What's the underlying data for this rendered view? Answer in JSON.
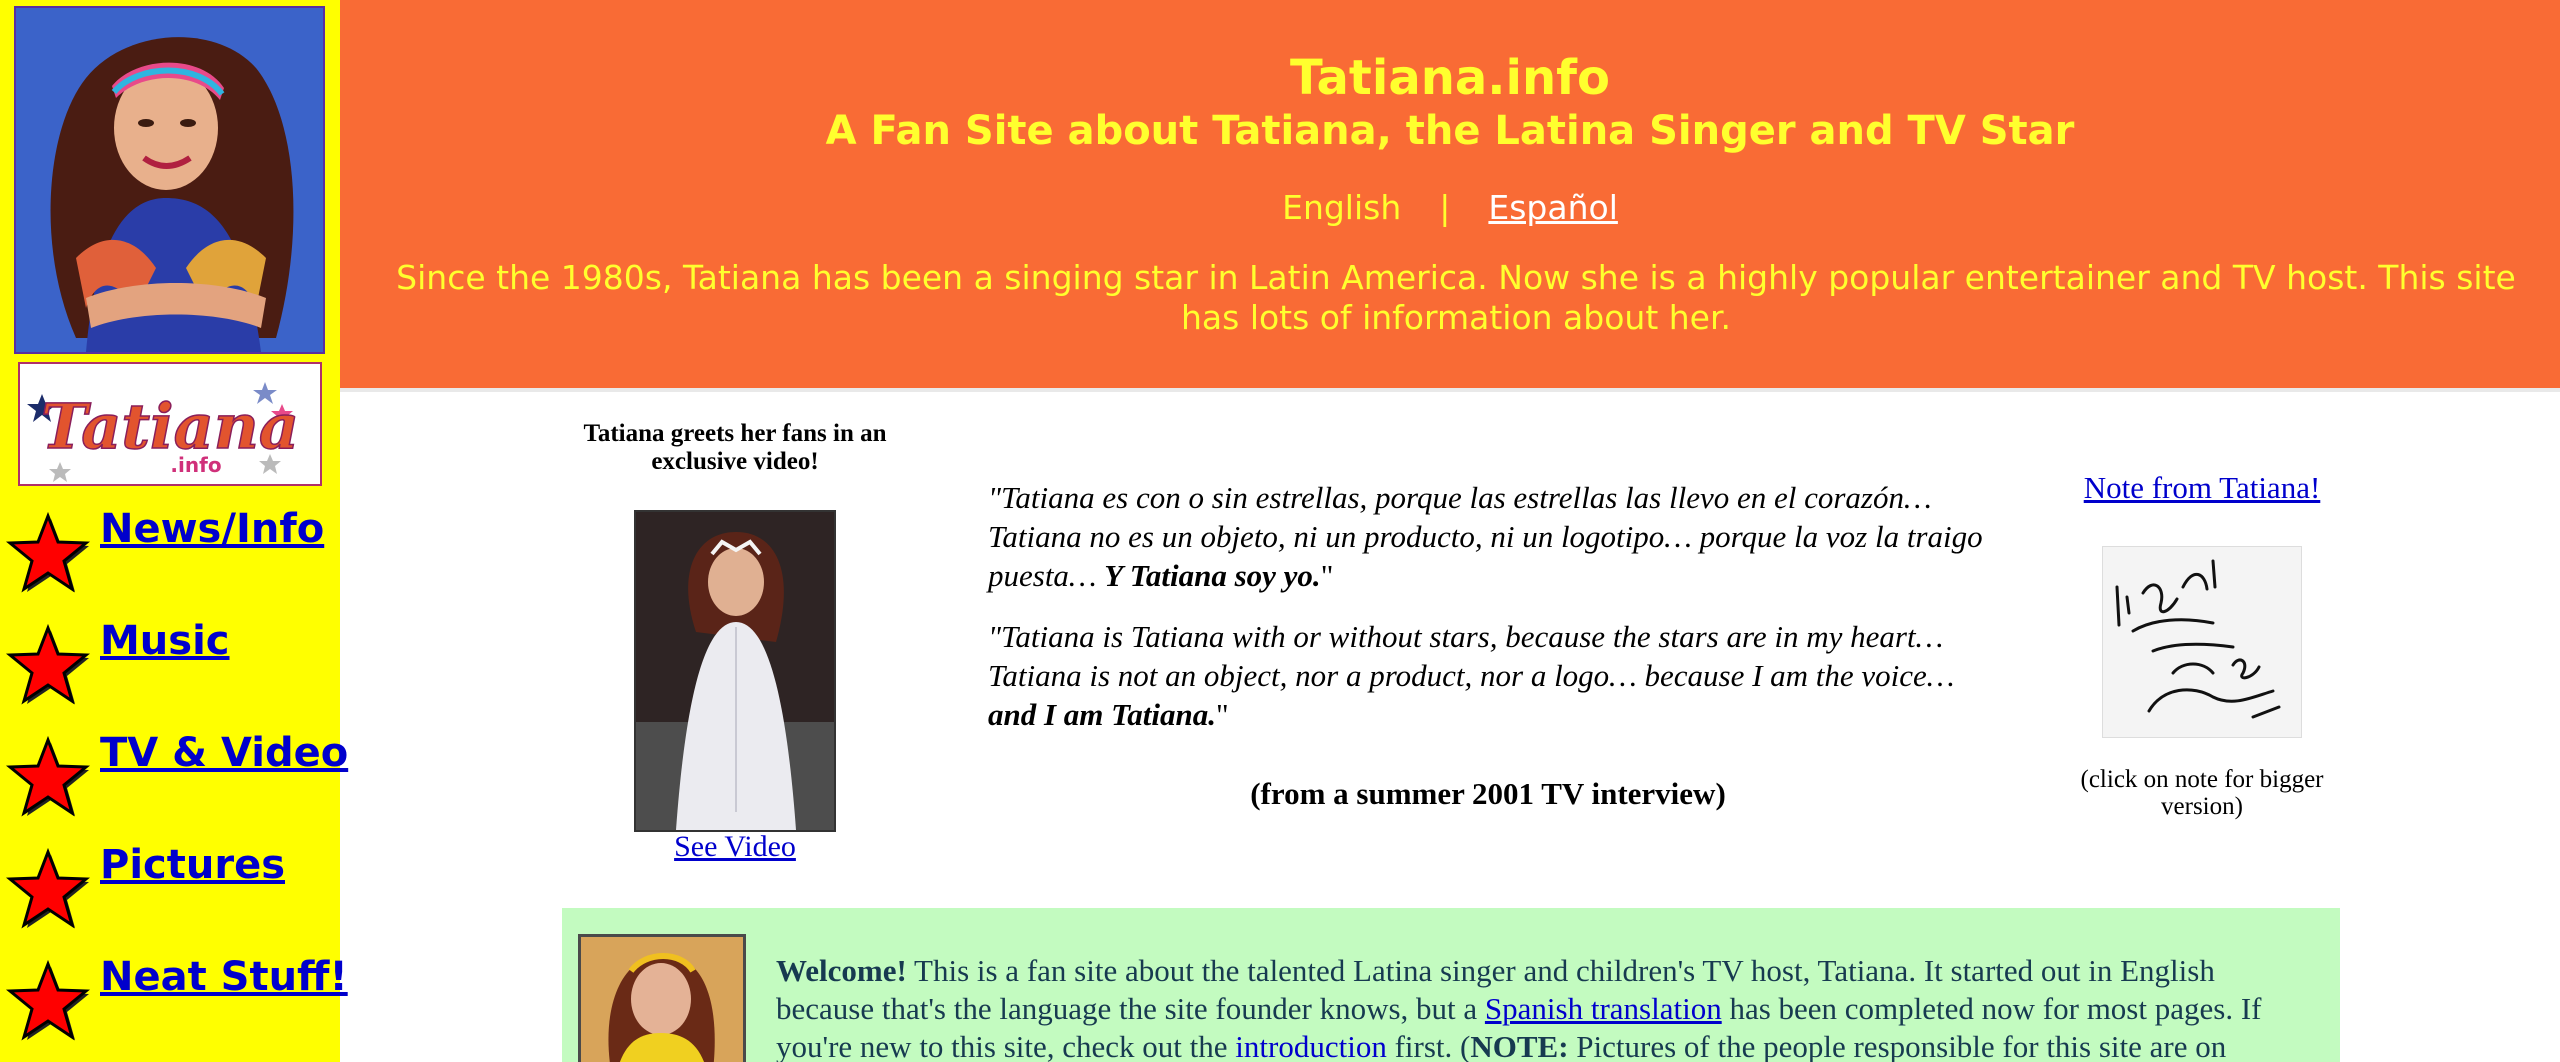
{
  "header": {
    "title": "Tatiana.info",
    "subtitle": "A Fan Site about Tatiana, the Latina Singer and TV Star",
    "lang_english": "English",
    "lang_separator": "|",
    "lang_spanish": "Español",
    "intro": "Since the 1980s, Tatiana has been a singing star in Latin America. Now she is a highly popular entertainer and TV host. This site has lots of information about her."
  },
  "sidebar": {
    "logo_text": "Tatiana",
    "logo_suffix": ".info",
    "items": [
      {
        "label": "News/Info",
        "icon": "star-icon"
      },
      {
        "label": "Music",
        "icon": "star-icon"
      },
      {
        "label": "TV & Video",
        "icon": "star-icon"
      },
      {
        "label": "Pictures",
        "icon": "star-icon"
      },
      {
        "label": "Neat Stuff!",
        "icon": "star-icon"
      }
    ]
  },
  "video": {
    "caption": "Tatiana greets her fans in an exclusive video!",
    "link": "See Video"
  },
  "quote": {
    "spanish_main": "\"Tatiana es con o sin estrellas, porque las estrellas las llevo en el corazón… Tatiana no es un objeto, ni un producto, ni un logotipo… porque la voz la traigo puesta… ",
    "spanish_bold": "Y Tatiana soy yo.",
    "spanish_close": "\"",
    "english_main": "\"Tatiana is Tatiana with or without stars, because the stars are in my heart… Tatiana is not an object, nor a product, nor a logo… because I am the voice… ",
    "english_bold": "and I am Tatiana.",
    "english_close": "\"",
    "source": "(from a summer 2001 TV interview)"
  },
  "note": {
    "link": "Note from Tatiana!",
    "hint": "(click on note for bigger version)"
  },
  "welcome": {
    "bold_intro": "Welcome!",
    "text_1": " This is a fan site about the talented Latina singer and children's TV host, Tatiana. It started out in English because that's the language the site founder knows, but a ",
    "link_spanish": "Spanish translation",
    "text_2": " has been completed now for most pages. If you're new to this site, check out the ",
    "link_intro": "introduction",
    "text_3": " first. (",
    "note_label": "NOTE:",
    "text_4": " Pictures of the people responsible for this site are on"
  },
  "colors": {
    "sidebar_bg": "#ffff00",
    "header_bg": "#f96b35",
    "header_text": "#ffff2e",
    "link": "#0000cc",
    "welcome_bg": "#c3fbc0",
    "star_fill": "#ff0000"
  }
}
